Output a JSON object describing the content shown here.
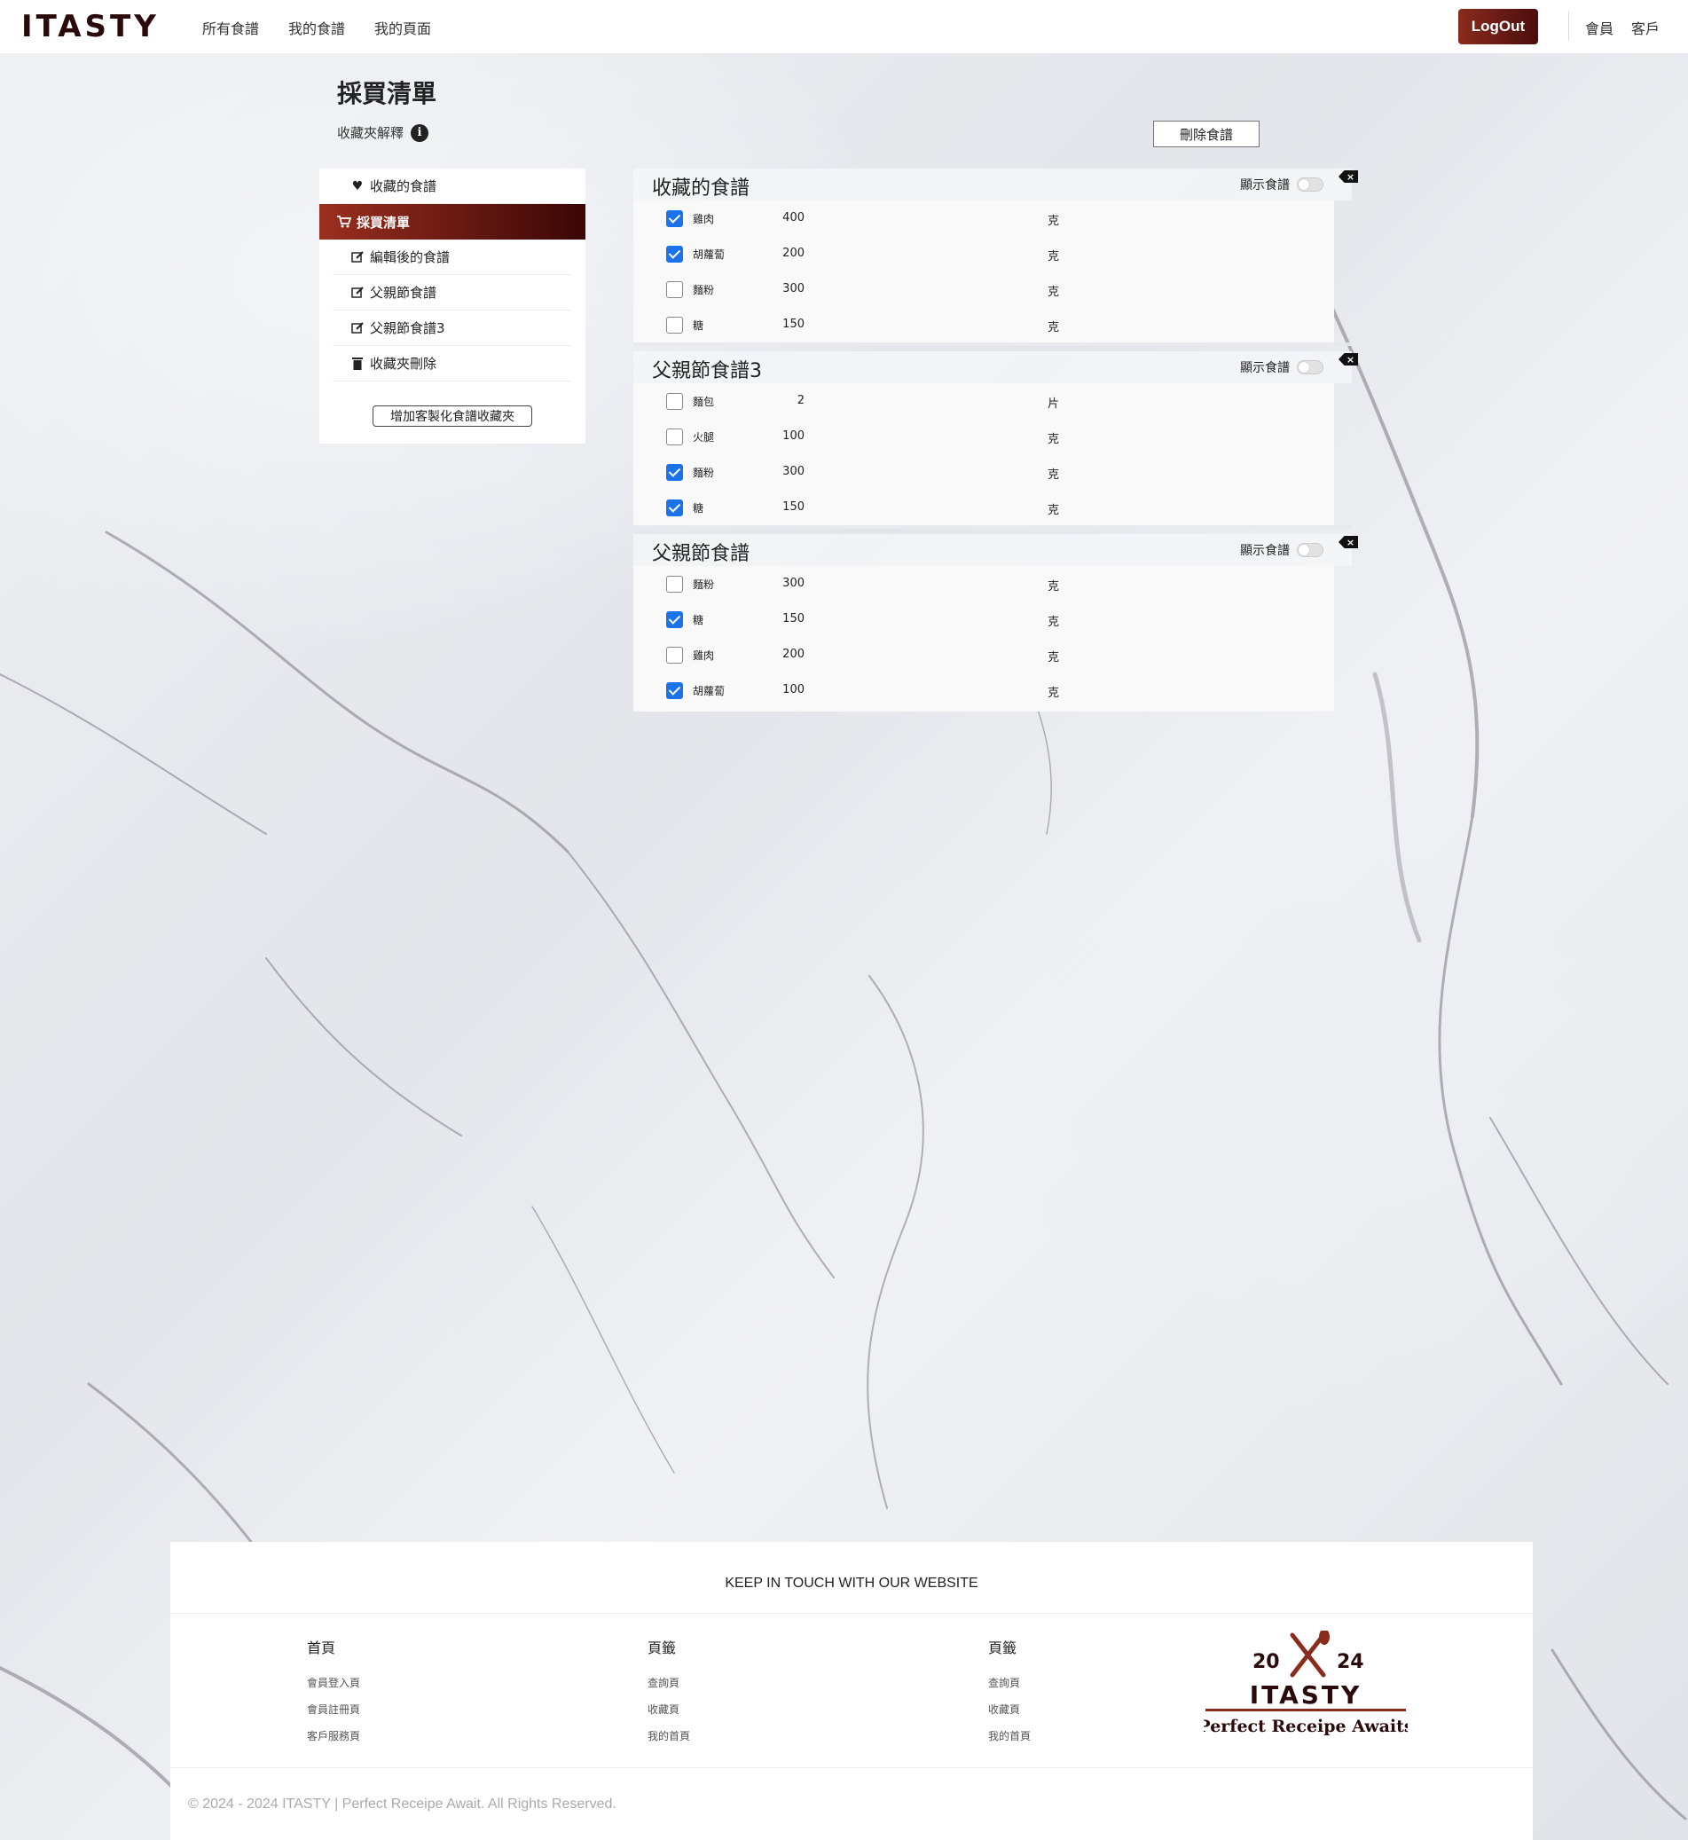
{
  "nav": {
    "brand": "ITASTY",
    "links": [
      "所有食譜",
      "我的食譜",
      "我的頁面"
    ],
    "logout_label": "LogOut",
    "right_links": [
      "會員",
      "客戶"
    ]
  },
  "page": {
    "title": "採買清單",
    "explain_label": "收藏夾解釋",
    "info_icon_glyph": "i",
    "delete_button": "刪除食譜"
  },
  "sidebar": {
    "items": [
      {
        "label": "收藏的食譜",
        "icon": "heart-icon"
      },
      {
        "label": "採買清單",
        "icon": "cart-icon",
        "active": true
      },
      {
        "label": "編輯後的食譜",
        "icon": "edit-icon"
      },
      {
        "label": "父親節食譜",
        "icon": "edit-icon"
      },
      {
        "label": "父親節食譜3",
        "icon": "edit-icon"
      },
      {
        "label": "收藏夾刪除",
        "icon": "trash-icon"
      }
    ],
    "add_button": "增加客製化食譜收藏夾"
  },
  "cards": [
    {
      "title": "收藏的食譜",
      "toggle_label": "顯示食譜",
      "close_glyph": "×",
      "ingredients": [
        {
          "name": "雞肉",
          "qty": "400",
          "unit": "克",
          "checked": true
        },
        {
          "name": "胡蘿蔔",
          "qty": "200",
          "unit": "克",
          "checked": true
        },
        {
          "name": "麵粉",
          "qty": "300",
          "unit": "克",
          "checked": false
        },
        {
          "name": "糖",
          "qty": "150",
          "unit": "克",
          "checked": false
        }
      ]
    },
    {
      "title": "父親節食譜3",
      "toggle_label": "顯示食譜",
      "close_glyph": "×",
      "ingredients": [
        {
          "name": "麵包",
          "qty": "2",
          "unit": "片",
          "checked": false
        },
        {
          "name": "火腿",
          "qty": "100",
          "unit": "克",
          "checked": false
        },
        {
          "name": "麵粉",
          "qty": "300",
          "unit": "克",
          "checked": true
        },
        {
          "name": "糖",
          "qty": "150",
          "unit": "克",
          "checked": true
        }
      ]
    },
    {
      "title": "父親節食譜",
      "toggle_label": "顯示食譜",
      "close_glyph": "×",
      "ingredients": [
        {
          "name": "麵粉",
          "qty": "300",
          "unit": "克",
          "checked": false
        },
        {
          "name": "糖",
          "qty": "150",
          "unit": "克",
          "checked": true
        },
        {
          "name": "雞肉",
          "qty": "200",
          "unit": "克",
          "checked": false
        },
        {
          "name": "胡蘿蔔",
          "qty": "100",
          "unit": "克",
          "checked": true
        }
      ]
    }
  ],
  "footer": {
    "keep_in_touch": "KEEP IN TOUCH WITH OUR WEBSITE",
    "columns": [
      {
        "heading": "首頁",
        "links": [
          "會員登入頁",
          "會員註冊頁",
          "客戶服務頁"
        ]
      },
      {
        "heading": "頁籤",
        "links": [
          "查詢頁",
          "收藏頁",
          "我的首頁"
        ]
      },
      {
        "heading": "頁籤",
        "links": [
          "查詢頁",
          "收藏頁",
          "我的首頁"
        ]
      }
    ],
    "logo": {
      "year_left": "20",
      "year_right": "24",
      "brand": "ITASTY",
      "tagline": "Perfect Receipe Awaits"
    },
    "copyright": "© 2024 - 2024 ITASTY | Perfect Receipe Await. All Rights Reserved."
  },
  "colors": {
    "accent_dark": "#3a0606",
    "accent": "#9b2f1f",
    "checkbox": "#1a73e8"
  }
}
